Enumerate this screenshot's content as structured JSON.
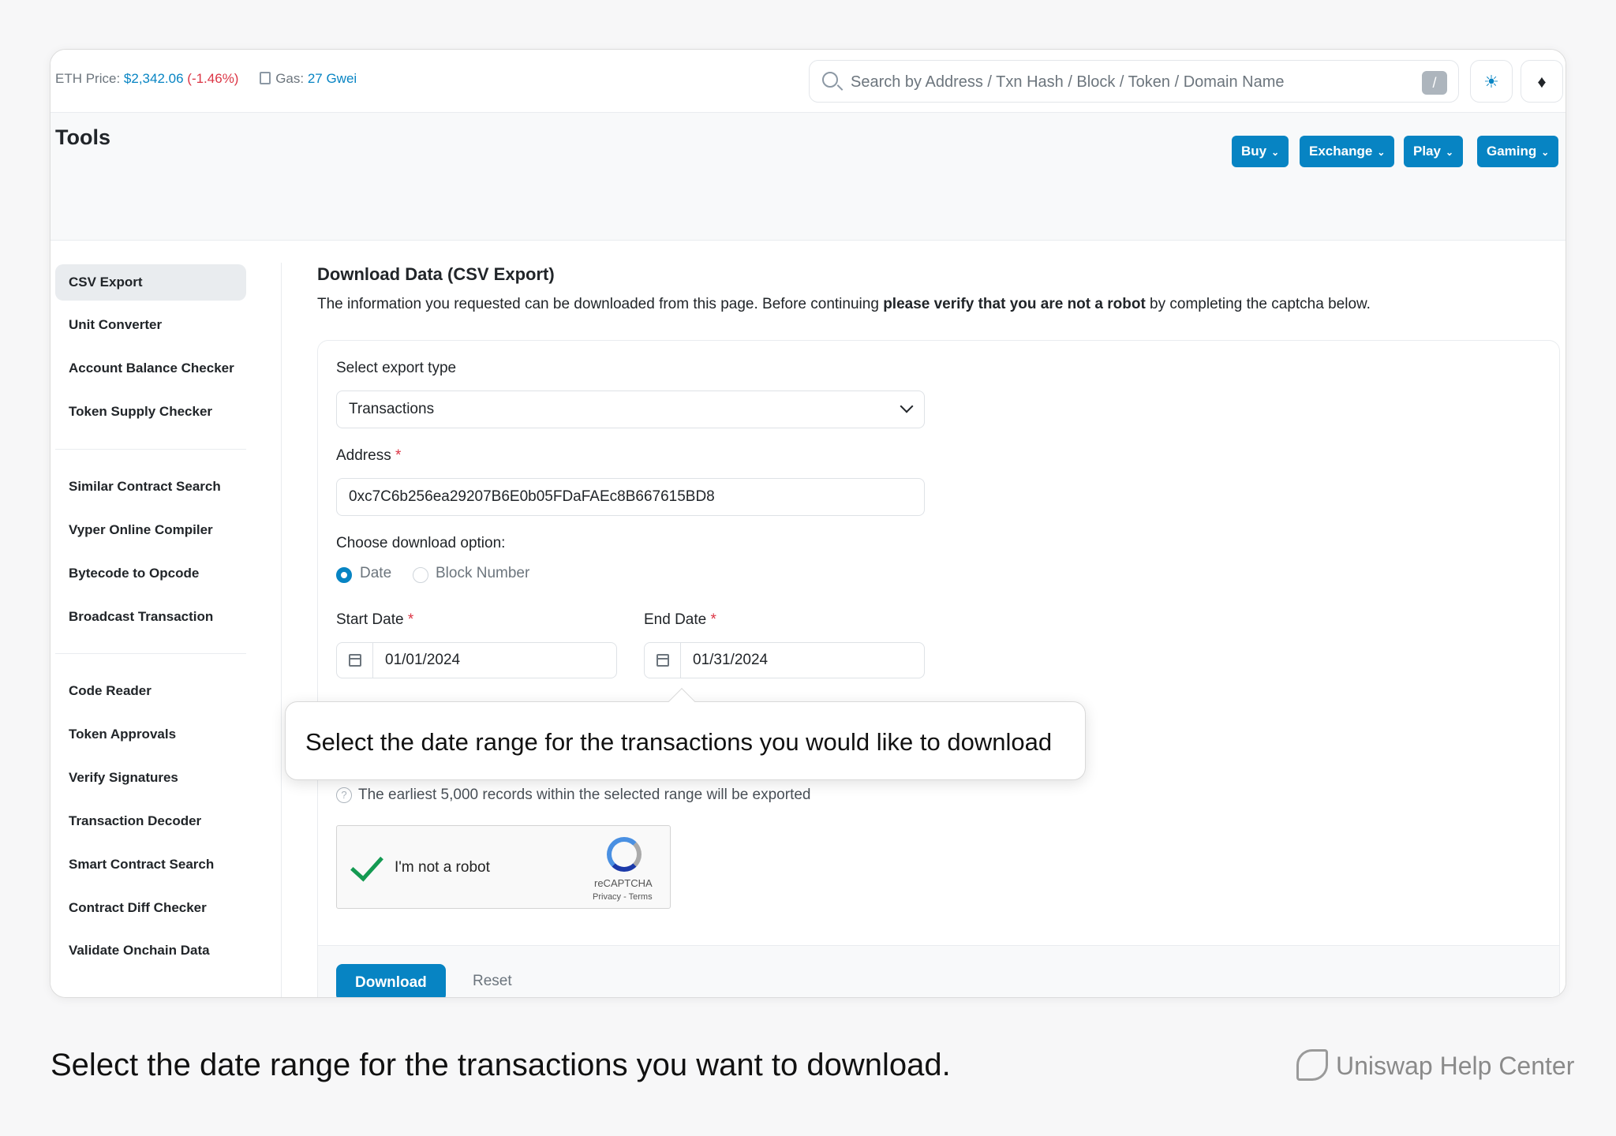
{
  "topbar": {
    "eth_price_label": "ETH Price: ",
    "eth_price_value": "$2,342.06",
    "eth_price_change": "(-1.46%)",
    "gas_label": "Gas: ",
    "gas_value": "27 Gwei",
    "search_placeholder": "Search by Address / Txn Hash / Block / Token / Domain Name",
    "search_shortcut": "/"
  },
  "header": {
    "title": "Tools",
    "buttons": [
      {
        "label": "Buy"
      },
      {
        "label": "Exchange"
      },
      {
        "label": "Play"
      },
      {
        "label": "Gaming"
      }
    ]
  },
  "sidebar": {
    "items": [
      {
        "label": "CSV Export",
        "active": true
      },
      {
        "label": "Unit Converter"
      },
      {
        "label": "Account Balance Checker"
      },
      {
        "label": "Token Supply Checker"
      },
      {
        "label": "Similar Contract Search"
      },
      {
        "label": "Vyper Online Compiler"
      },
      {
        "label": "Bytecode to Opcode"
      },
      {
        "label": "Broadcast Transaction"
      },
      {
        "label": "Code Reader"
      },
      {
        "label": "Token Approvals"
      },
      {
        "label": "Verify Signatures"
      },
      {
        "label": "Transaction Decoder"
      },
      {
        "label": "Smart Contract Search"
      },
      {
        "label": "Contract Diff Checker"
      },
      {
        "label": "Validate Onchain Data"
      }
    ]
  },
  "main": {
    "title": "Download Data (CSV Export)",
    "desc_before": "The information you requested can be downloaded from this page. Before continuing ",
    "desc_bold": "please verify that you are not a robot",
    "desc_after": " by completing the captcha below.",
    "export_type_label": "Select export type",
    "export_type_value": "Transactions",
    "address_label": "Address",
    "address_value": "0xc7C6b256ea29207B6E0b05FDaFAEc8B667615BD8",
    "download_option_label": "Choose download option:",
    "options": [
      {
        "label": "Date",
        "selected": true
      },
      {
        "label": "Block Number",
        "selected": false
      }
    ],
    "start_date_label": "Start Date",
    "start_date_value": "01/01/2024",
    "end_date_label": "End Date",
    "end_date_value": "01/31/2024",
    "required_mark": "*",
    "note": "The earliest 5,000 records within the selected range will be exported",
    "captcha": {
      "label": "I'm not a robot",
      "brand": "reCAPTCHA",
      "terms": "Privacy - Terms"
    },
    "download_button": "Download",
    "reset_button": "Reset"
  },
  "tooltip": {
    "text": "Select the date range for the transactions you would like to download"
  },
  "caption": {
    "text": "Select the date range for the transactions you want to download.",
    "brand": "Uniswap Help Center"
  },
  "colors": {
    "accent": "#0784c3",
    "negative": "#dc3545",
    "required": "#dc3545"
  }
}
